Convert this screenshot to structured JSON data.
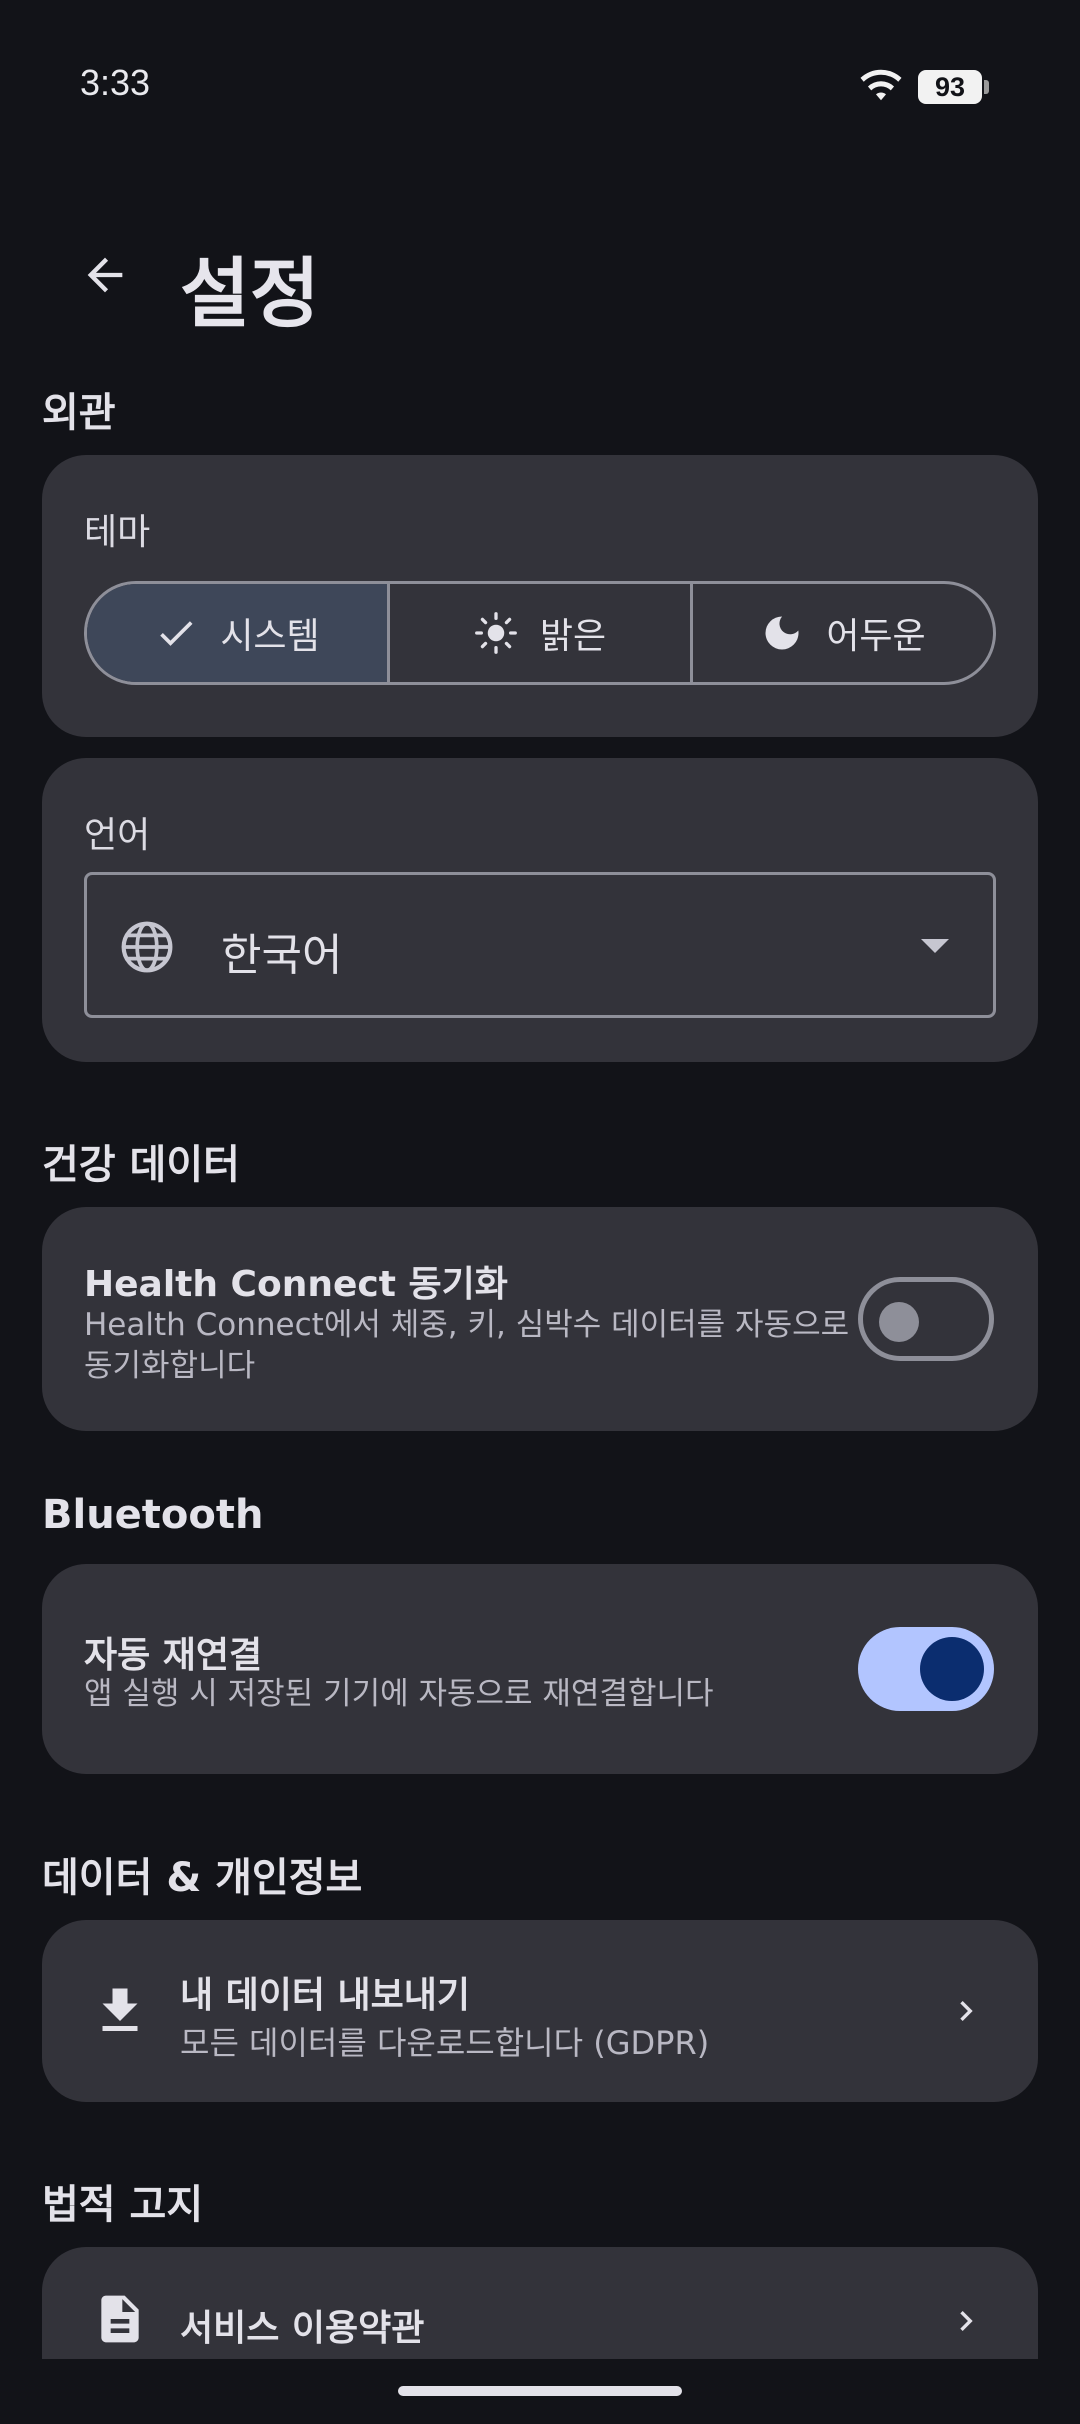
{
  "status_bar": {
    "time": "3:33",
    "battery": "93"
  },
  "header": {
    "title": "설정"
  },
  "appearance": {
    "section_title": "외관",
    "theme_label": "테마",
    "theme_options": [
      "시스템",
      "밝은",
      "어두운"
    ],
    "selected_theme": "시스템",
    "language_label": "언어",
    "language_value": "한국어"
  },
  "health": {
    "section_title": "건강 데이터",
    "title": "Health Connect 동기화",
    "desc_line1": "Health Connect에서 체중, 키, 심박수 데이터를 자동으로",
    "desc_line2": "동기화합니다",
    "enabled": false
  },
  "bluetooth": {
    "section_title": "Bluetooth",
    "title": "자동 재연결",
    "desc": "앱 실행 시 저장된 기기에 자동으로 재연결합니다",
    "enabled": true
  },
  "privacy": {
    "section_title": "데이터 & 개인정보",
    "export_title": "내 데이터 내보내기",
    "export_desc": "모든 데이터를 다운로드합니다 (GDPR)"
  },
  "legal": {
    "section_title": "법적 고지",
    "terms_title": "서비스 이용약관"
  },
  "colors": {
    "background": "#121318",
    "card": "#33333a",
    "segment_selected": "#3e4759",
    "toggle_on_track": "#b2c5ff",
    "toggle_on_thumb": "#0b2d6f"
  }
}
